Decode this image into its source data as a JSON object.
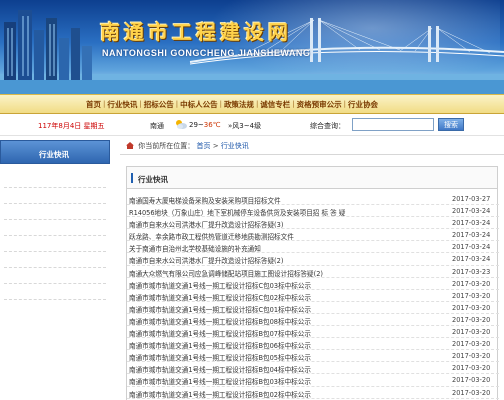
{
  "banner": {
    "title": "南通市工程建设网",
    "subtitle": "NANTONGSHI GONGCHENG JIANSHEWANG"
  },
  "nav": {
    "items": [
      "首页",
      "行业快讯",
      "招标公告",
      "中标人公告",
      "政策法规",
      "诚信专栏",
      "资格预审公示",
      "行业协会"
    ],
    "separator": "|"
  },
  "info": {
    "date": "117年8月4日 星期五",
    "city": "南通",
    "weather_icon": "cloud-sun-icon",
    "temp_low": "29~",
    "temp_high": "36℃",
    "wind": "风3~4级",
    "wind_arrow": "»",
    "search_label": "综合查询：",
    "search_value": "",
    "search_button": "搜索"
  },
  "sidebar": {
    "title": "行业快讯",
    "row_count": 8
  },
  "breadcrumb": {
    "prefix": "你当前所在位置：",
    "home": "首页",
    "sep": ">",
    "current": "行业快讯"
  },
  "section": {
    "title": "行业快讯"
  },
  "news": [
    {
      "title": "南通国寿大厦电梯设备采购及安装采购项目招标文件",
      "date": "2017-03-27"
    },
    {
      "title": "R14056地块（万象山庄）地下室机械停车设备供货及安装项目招 标 答 疑",
      "date": "2017-03-24"
    },
    {
      "title": "南通市自来水公司洪港水厂提升改造设计招标答疑(3)",
      "date": "2017-03-24"
    },
    {
      "title": "跃龙路、幸余路市政工程供热管道迁移地质勘测招标文件",
      "date": "2017-03-24"
    },
    {
      "title": "关于南通市自治州北学校基础设施的补充通知",
      "date": "2017-03-24"
    },
    {
      "title": "南通市自来水公司洪港水厂提升改造设计招标答疑(2)",
      "date": "2017-03-24"
    },
    {
      "title": "南通大众燃气有限公司应急调峰储配站项目施工图设计招标答疑(2)",
      "date": "2017-03-23"
    },
    {
      "title": "南通市城市轨道交通1号线一期工程设计招标C包03标中标公示",
      "date": "2017-03-20"
    },
    {
      "title": "南通市城市轨道交通1号线一期工程设计招标C包02标中标公示",
      "date": "2017-03-20"
    },
    {
      "title": "南通市城市轨道交通1号线一期工程设计招标C包01标中标公示",
      "date": "2017-03-20"
    },
    {
      "title": "南通市城市轨道交通1号线一期工程设计招标B包08标中标公示",
      "date": "2017-03-20"
    },
    {
      "title": "南通市城市轨道交通1号线一期工程设计招标B包07标中标公示",
      "date": "2017-03-20"
    },
    {
      "title": "南通市城市轨道交通1号线一期工程设计招标B包06标中标公示",
      "date": "2017-03-20"
    },
    {
      "title": "南通市城市轨道交通1号线一期工程设计招标B包05标中标公示",
      "date": "2017-03-20"
    },
    {
      "title": "南通市城市轨道交通1号线一期工程设计招标B包04标中标公示",
      "date": "2017-03-20"
    },
    {
      "title": "南通市城市轨道交通1号线一期工程设计招标B包03标中标公示",
      "date": "2017-03-20"
    },
    {
      "title": "南通市城市轨道交通1号线一期工程设计招标B包02标中标公示",
      "date": "2017-03-20"
    },
    {
      "title": "南通市城市轨道交通1号线一期工程设计招标B包01标中标公示",
      "date": "2017-03-20"
    }
  ],
  "colors": {
    "nav_text": "#7a3a00",
    "date_red": "#cc0000",
    "sidebar_blue": "#2f66b0",
    "link_blue": "#1a54a8"
  }
}
